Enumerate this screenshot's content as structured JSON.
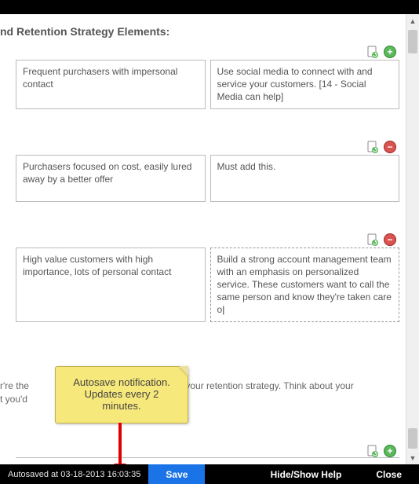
{
  "heading": "nd Retention Strategy Elements:",
  "sections": [
    {
      "left": "Frequent purchasers with impersonal contact",
      "right": "Use social media to connect with and service your customers. [14 - Social Media can help]",
      "hasAdd": true,
      "hasRemove": false
    },
    {
      "left": "Purchasers focused on cost, easily lured away by a better offer",
      "right": "Must add this.",
      "hasAdd": true,
      "hasRemove": true
    },
    {
      "left": "High value customers with high importance, lots of personal contact",
      "right": "Build a strong account management team with an emphasis on personalized service. These customers want to call the same person and know they're taken care o",
      "hasAdd": true,
      "hasRemove": true,
      "editing": true
    }
  ],
  "midtext_left": "r're the",
  "midtext_right": " in your retention strategy. Think about your",
  "midtext_line2": "t you'd",
  "note_line1": "Autosave notification.",
  "note_line2": "Updates every 2",
  "note_line3": "minutes.",
  "bottombar": {
    "autosave": "Autosaved at 03-18-2013 16:03:35",
    "save": "Save",
    "help": "Hide/Show Help",
    "close": "Close"
  },
  "icons": {
    "page": "page-refresh-icon",
    "add": "add-icon",
    "remove": "remove-icon"
  }
}
